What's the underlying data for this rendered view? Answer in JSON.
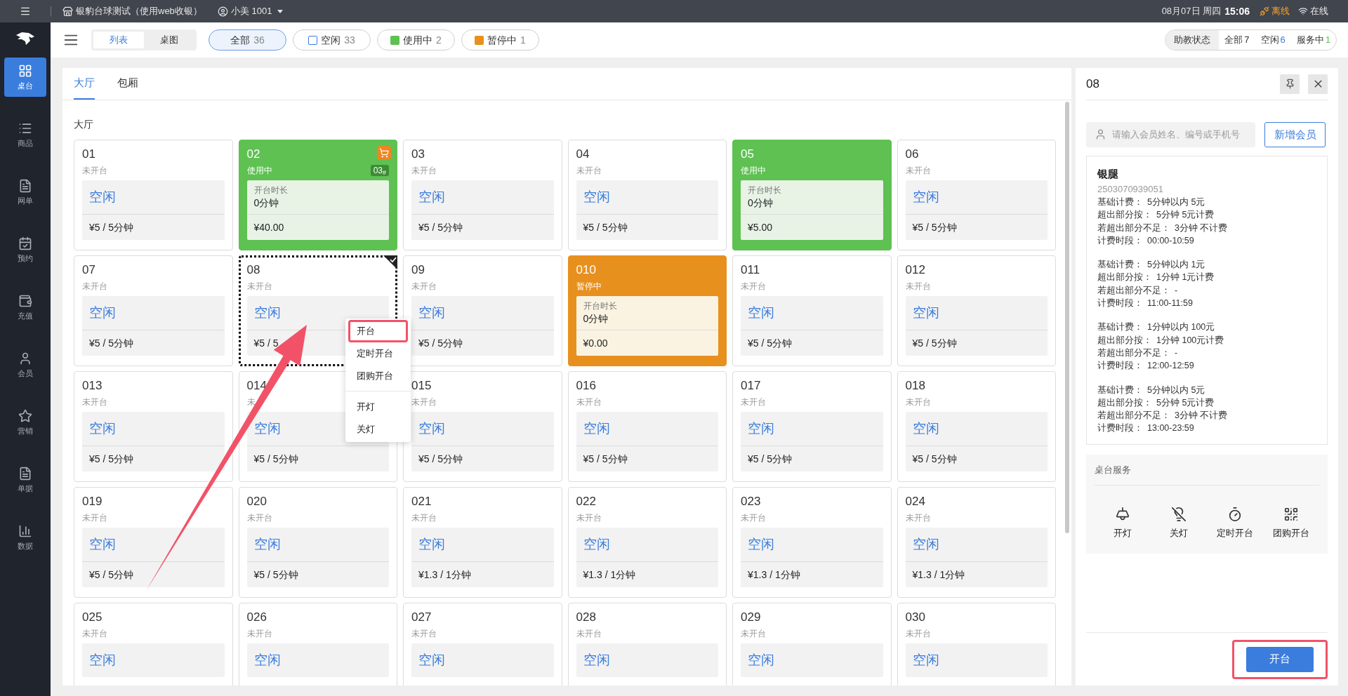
{
  "top_bar": {
    "store": "银豹台球测试（使用web收银）",
    "user": "小美 1001",
    "date": "08月07日 周四",
    "time": "15:06",
    "offline": "离线",
    "online": "在线"
  },
  "sidebar": [
    {
      "label": "桌台",
      "selected": true
    },
    {
      "label": "商品",
      "selected": false
    },
    {
      "label": "网单",
      "selected": false
    },
    {
      "label": "预约",
      "selected": false
    },
    {
      "label": "充值",
      "selected": false
    },
    {
      "label": "会员",
      "selected": false
    },
    {
      "label": "营销",
      "selected": false
    },
    {
      "label": "单据",
      "selected": false
    },
    {
      "label": "数据",
      "selected": false
    }
  ],
  "view_toggle": [
    {
      "label": "列表",
      "selected": true
    },
    {
      "label": "桌图",
      "selected": false
    }
  ],
  "filters": [
    {
      "label": "全部",
      "count": "36",
      "selected": true,
      "kind": "plain"
    },
    {
      "label": "空闲",
      "count": "33",
      "selected": false,
      "kind": "outline",
      "color": "#3b7ddd"
    },
    {
      "label": "使用中",
      "count": "2",
      "selected": false,
      "kind": "filled",
      "color": "#5ec152"
    },
    {
      "label": "暂停中",
      "count": "1",
      "selected": false,
      "kind": "filled",
      "color": "#e8901e"
    }
  ],
  "assistant_status": {
    "label": "助教状态",
    "items": [
      {
        "label": "全部",
        "count": "7",
        "color": "#333333"
      },
      {
        "label": "空闲",
        "count": "6",
        "color": "#3b7ddd"
      },
      {
        "label": "服务中",
        "count": "1",
        "color": "#5ec152"
      }
    ]
  },
  "area_tabs": [
    {
      "label": "大厅",
      "selected": true
    },
    {
      "label": "包厢",
      "selected": false
    }
  ],
  "section_title": "大厅",
  "tables": [
    {
      "number": "01",
      "status": "未开台",
      "kind": "idle",
      "idle_label": "空闲",
      "price": "¥5 / 5分钟",
      "selected": false
    },
    {
      "number": "02",
      "status": "使用中",
      "kind": "in_use",
      "duration_label": "开台时长",
      "duration": "0分钟",
      "amount": "¥40.00",
      "cart": true,
      "badge": "03$_{#}$",
      "selected": false
    },
    {
      "number": "03",
      "status": "未开台",
      "kind": "idle",
      "idle_label": "空闲",
      "price": "¥5 / 5分钟",
      "selected": false
    },
    {
      "number": "04",
      "status": "未开台",
      "kind": "idle",
      "idle_label": "空闲",
      "price": "¥5 / 5分钟",
      "selected": false
    },
    {
      "number": "05",
      "status": "使用中",
      "kind": "in_use",
      "duration_label": "开台时长",
      "duration": "0分钟",
      "amount": "¥5.00",
      "cart": false,
      "selected": false
    },
    {
      "number": "06",
      "status": "未开台",
      "kind": "idle",
      "idle_label": "空闲",
      "price": "¥5 / 5分钟",
      "selected": false
    },
    {
      "number": "07",
      "status": "未开台",
      "kind": "idle",
      "idle_label": "空闲",
      "price": "¥5 / 5分钟",
      "selected": false
    },
    {
      "number": "08",
      "status": "未开台",
      "kind": "idle",
      "idle_label": "空闲",
      "price": "¥5 / 5",
      "selected": true
    },
    {
      "number": "09",
      "status": "未开台",
      "kind": "idle",
      "idle_label": "空闲",
      "price": "¥5 / 5分钟",
      "selected": false
    },
    {
      "number": "010",
      "status": "暂停中",
      "kind": "paused",
      "duration_label": "开台时长",
      "duration": "0分钟",
      "amount": "¥0.00",
      "cart": false,
      "selected": false
    },
    {
      "number": "011",
      "status": "未开台",
      "kind": "idle",
      "idle_label": "空闲",
      "price": "¥5 / 5分钟",
      "selected": false
    },
    {
      "number": "012",
      "status": "未开台",
      "kind": "idle",
      "idle_label": "空闲",
      "price": "¥5 / 5分钟",
      "selected": false
    },
    {
      "number": "013",
      "status": "未开台",
      "kind": "idle",
      "idle_label": "空闲",
      "price": "¥5 / 5分钟",
      "selected": false
    },
    {
      "number": "014",
      "status": "未",
      "kind": "idle",
      "idle_label": "空闲",
      "price": "¥5 / 5分钟",
      "selected": false
    },
    {
      "number": "015",
      "status": "未开台",
      "kind": "idle",
      "idle_label": "空闲",
      "price": "¥5 / 5分钟",
      "selected": false
    },
    {
      "number": "016",
      "status": "未开台",
      "kind": "idle",
      "idle_label": "空闲",
      "price": "¥5 / 5分钟",
      "selected": false
    },
    {
      "number": "017",
      "status": "未开台",
      "kind": "idle",
      "idle_label": "空闲",
      "price": "¥5 / 5分钟",
      "selected": false
    },
    {
      "number": "018",
      "status": "未开台",
      "kind": "idle",
      "idle_label": "空闲",
      "price": "¥5 / 5分钟",
      "selected": false
    },
    {
      "number": "019",
      "status": "未开台",
      "kind": "idle",
      "idle_label": "空闲",
      "price": "¥5 / 5分钟",
      "selected": false
    },
    {
      "number": "020",
      "status": "未开台",
      "kind": "idle",
      "idle_label": "空闲",
      "price": "¥5 / 5分钟",
      "selected": false
    },
    {
      "number": "021",
      "status": "未开台",
      "kind": "idle",
      "idle_label": "空闲",
      "price": "¥1.3 / 1分钟",
      "selected": false
    },
    {
      "number": "022",
      "status": "未开台",
      "kind": "idle",
      "idle_label": "空闲",
      "price": "¥1.3 / 1分钟",
      "selected": false
    },
    {
      "number": "023",
      "status": "未开台",
      "kind": "idle",
      "idle_label": "空闲",
      "price": "¥1.3 / 1分钟",
      "selected": false
    },
    {
      "number": "024",
      "status": "未开台",
      "kind": "idle",
      "idle_label": "空闲",
      "price": "¥1.3 / 1分钟",
      "selected": false
    },
    {
      "number": "025",
      "status": "未开台",
      "kind": "idle",
      "idle_label": "空闲",
      "selected": false
    },
    {
      "number": "026",
      "status": "未开台",
      "kind": "idle",
      "idle_label": "空闲",
      "selected": false
    },
    {
      "number": "027",
      "status": "未开台",
      "kind": "idle",
      "idle_label": "空闲",
      "selected": false
    },
    {
      "number": "028",
      "status": "未开台",
      "kind": "idle",
      "idle_label": "空闲",
      "selected": false
    },
    {
      "number": "029",
      "status": "未开台",
      "kind": "idle",
      "idle_label": "空闲",
      "selected": false
    },
    {
      "number": "030",
      "status": "未开台",
      "kind": "idle",
      "idle_label": "空闲",
      "selected": false
    }
  ],
  "context_menu": {
    "groups": [
      [
        {
          "label": "开台",
          "highlighted": true
        },
        {
          "label": "定时开台",
          "highlighted": false
        },
        {
          "label": "团购开台",
          "highlighted": false
        }
      ],
      [
        {
          "label": "开灯",
          "highlighted": false
        },
        {
          "label": "关灯",
          "highlighted": false
        }
      ]
    ]
  },
  "detail_panel": {
    "title": "08",
    "member_search": {
      "placeholder": "请输入会员姓名、编号或手机号"
    },
    "add_member": "新增会员",
    "rate": {
      "name": "银腿",
      "code": "2503070939051",
      "periods": [
        [
          {
            "label": "基础计费：",
            "value": "5分钟以内 5元"
          },
          {
            "label": "超出部分按：",
            "value": "5分钟 5元计费"
          },
          {
            "label": "若超出部分不足：",
            "value": "3分钟 不计费"
          },
          {
            "label": "计费时段：",
            "value": "00:00-10:59"
          }
        ],
        [
          {
            "label": "基础计费：",
            "value": "5分钟以内 1元"
          },
          {
            "label": "超出部分按：",
            "value": "1分钟 1元计费"
          },
          {
            "label": "若超出部分不足：",
            "value": "-"
          },
          {
            "label": "计费时段：",
            "value": "11:00-11:59"
          }
        ],
        [
          {
            "label": "基础计费：",
            "value": "1分钟以内 100元"
          },
          {
            "label": "超出部分按：",
            "value": "1分钟 100元计费"
          },
          {
            "label": "若超出部分不足：",
            "value": "-"
          },
          {
            "label": "计费时段：",
            "value": "12:00-12:59"
          }
        ],
        [
          {
            "label": "基础计费：",
            "value": "5分钟以内 5元"
          },
          {
            "label": "超出部分按：",
            "value": "5分钟 5元计费"
          },
          {
            "label": "若超出部分不足：",
            "value": "3分钟 不计费"
          },
          {
            "label": "计费时段：",
            "value": "13:00-23:59"
          }
        ]
      ]
    },
    "services": {
      "title": "桌台服务",
      "items": [
        {
          "label": "开灯"
        },
        {
          "label": "关灯"
        },
        {
          "label": "定时开台"
        },
        {
          "label": "团购开台"
        }
      ]
    },
    "primary_button": {
      "label": "开台",
      "highlighted": true
    }
  }
}
